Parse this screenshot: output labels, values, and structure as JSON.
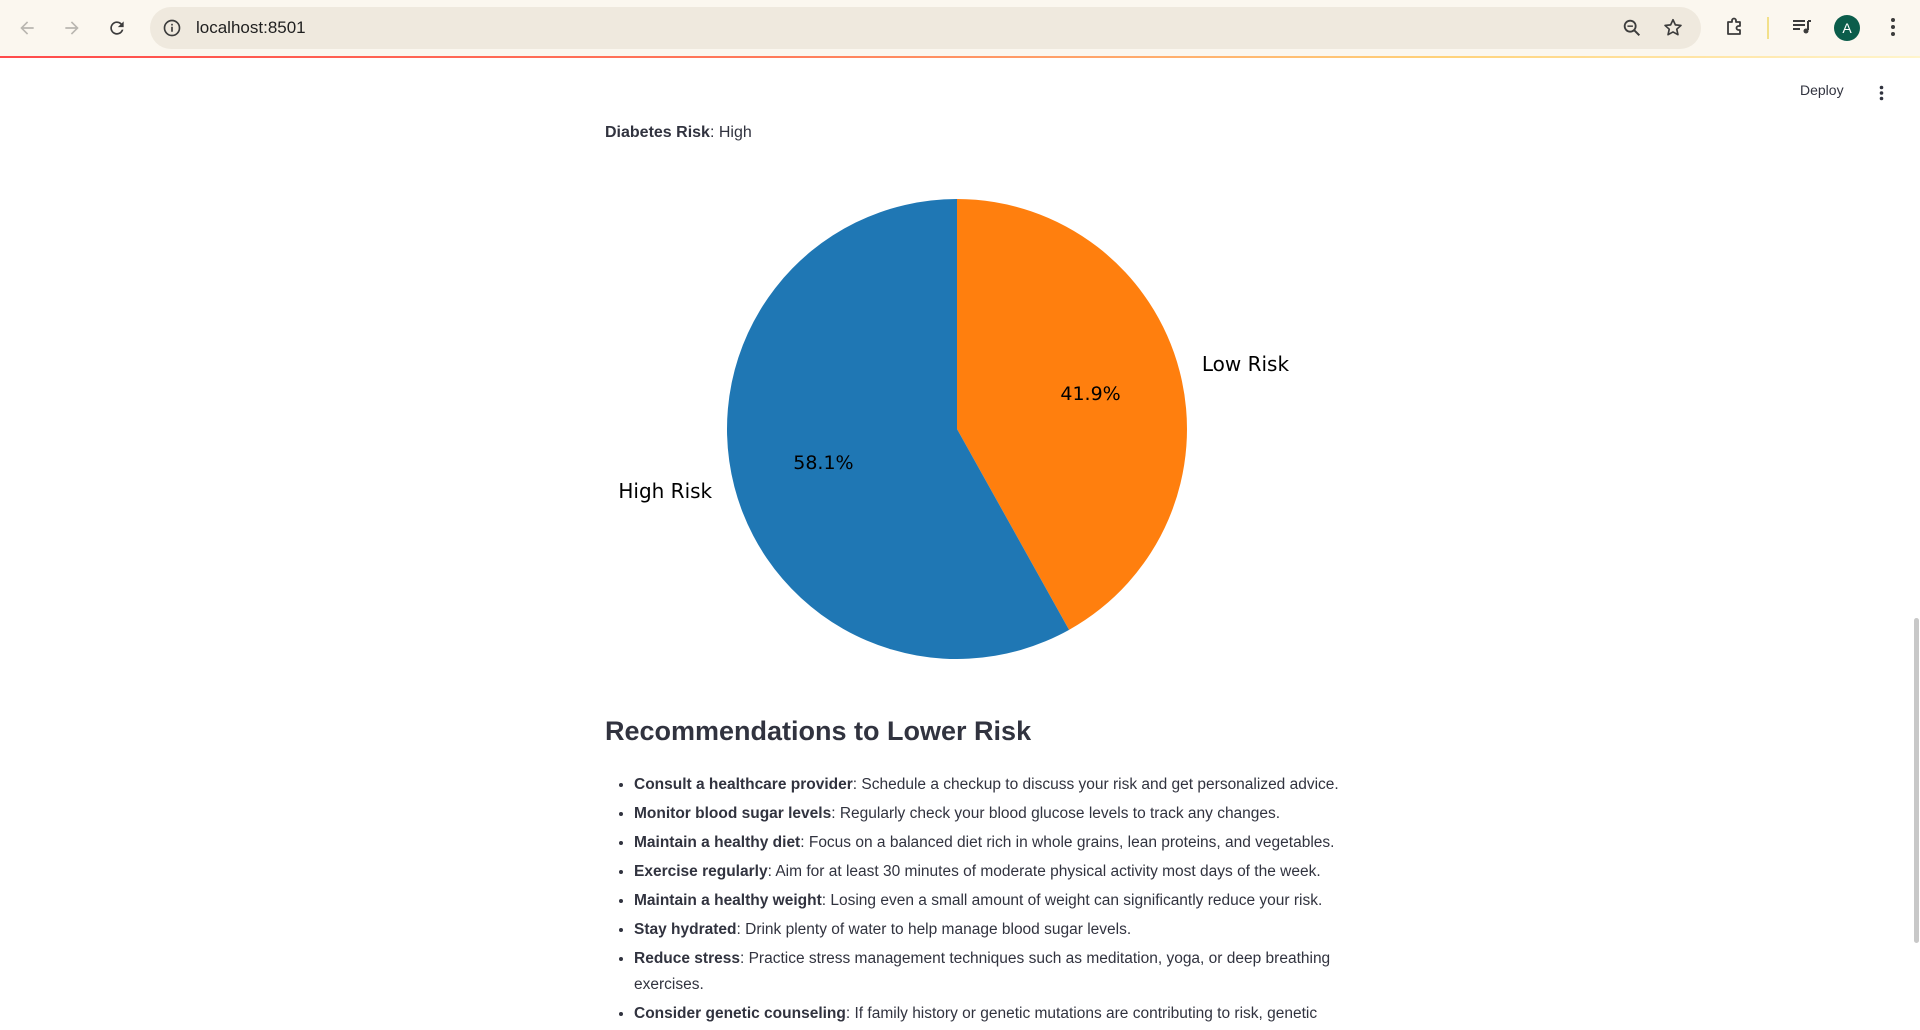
{
  "browser": {
    "url": "localhost:8501",
    "avatar_letter": "A",
    "icons": [
      "back-icon",
      "forward-icon",
      "reload-icon",
      "site-info-icon",
      "zoom-icon",
      "bookmark-star-icon",
      "extensions-icon",
      "media-control-icon",
      "more-vert-icon"
    ]
  },
  "app": {
    "deploy_label": "Deploy"
  },
  "result": {
    "risk_label": "Diabetes Risk",
    "risk_separator": ": ",
    "risk_value": "High"
  },
  "chart_data": {
    "type": "pie",
    "labels": [
      "Low Risk",
      "High Risk"
    ],
    "values": [
      41.9,
      58.1
    ],
    "autopct_labels": [
      "41.9%",
      "58.1%"
    ],
    "colors": [
      "#ff7f0e",
      "#1f77b4"
    ],
    "start_angle_deg": 90,
    "direction": "clockwise"
  },
  "recommendations": {
    "title": "Recommendations to Lower Risk",
    "items": [
      {
        "term": "Consult a healthcare provider",
        "text": ": Schedule a checkup to discuss your risk and get personalized advice."
      },
      {
        "term": "Monitor blood sugar levels",
        "text": ": Regularly check your blood glucose levels to track any changes."
      },
      {
        "term": "Maintain a healthy diet",
        "text": ": Focus on a balanced diet rich in whole grains, lean proteins, and vegetables."
      },
      {
        "term": "Exercise regularly",
        "text": ": Aim for at least 30 minutes of moderate physical activity most days of the week."
      },
      {
        "term": "Maintain a healthy weight",
        "text": ": Losing even a small amount of weight can significantly reduce your risk."
      },
      {
        "term": "Stay hydrated",
        "text": ": Drink plenty of water to help manage blood sugar levels."
      },
      {
        "term": "Reduce stress",
        "text": ": Practice stress management techniques such as meditation, yoga, or deep breathing exercises."
      },
      {
        "term": "Consider genetic counseling",
        "text": ": If family history or genetic mutations are contributing to risk, genetic"
      }
    ]
  }
}
